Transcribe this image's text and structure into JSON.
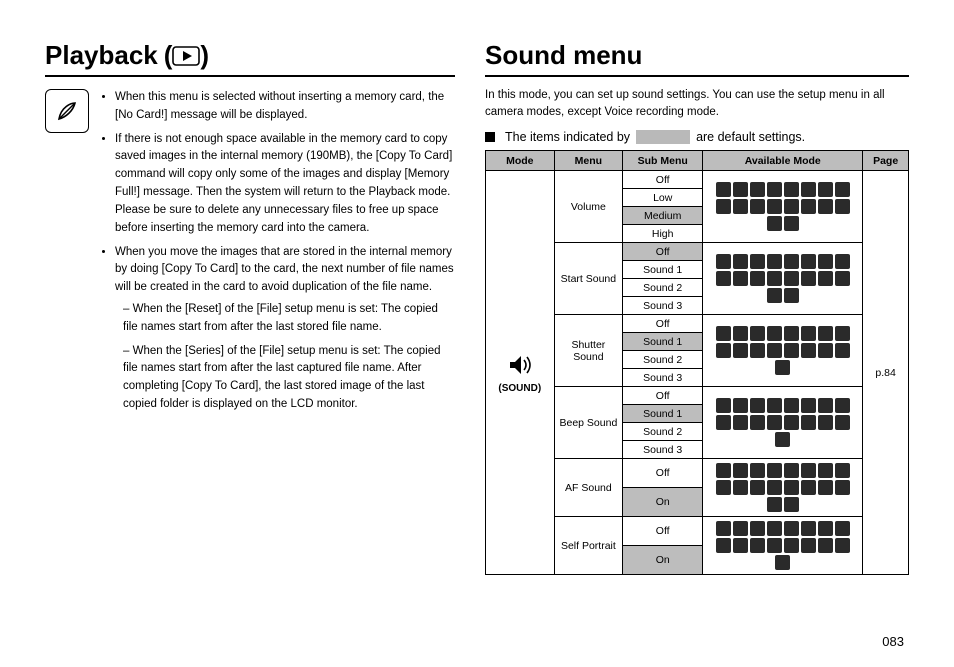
{
  "left": {
    "heading": "Playback",
    "bullets": [
      "When this menu is selected without inserting a memory card, the [No Card!] message will be displayed.",
      "If there is not enough space available in the memory card to copy saved images in the internal memory (190MB), the [Copy To Card] command will copy only some of the images and display [Memory Full!] message. Then the system will return to the Playback mode. Please be sure to delete any unnecessary files to free up space before inserting the memory card into the camera.",
      "When you move the images that are stored in the internal memory by doing [Copy To Card] to the card, the next number of file names will be created in the card to avoid duplication of the file name."
    ],
    "subpoints": [
      "When the [Reset] of the [File] setup menu is set: The copied file names start from after the last stored file name.",
      "When the [Series] of the [File] setup menu is set: The copied file names start from after the last captured file name. After completing [Copy To Card], the last stored image of the last copied folder is displayed on the LCD monitor."
    ]
  },
  "right": {
    "heading": "Sound menu",
    "intro": "In this mode, you can set up sound settings. You can use the setup menu in all camera modes, except Voice recording mode.",
    "default_note_pre": "The items indicated by",
    "default_note_post": "are default settings.",
    "table": {
      "headers": [
        "Mode",
        "Menu",
        "Sub Menu",
        "Available Mode",
        "Page"
      ],
      "mode_label": "(SOUND)",
      "page_ref": "p.84",
      "icon_count_full": 18,
      "icon_count_small": 17,
      "groups": [
        {
          "menu": "Volume",
          "items": [
            "Off",
            "Low",
            "Medium",
            "High"
          ],
          "default": "Medium",
          "icons": 18
        },
        {
          "menu": "Start Sound",
          "items": [
            "Off",
            "Sound 1",
            "Sound 2",
            "Sound 3"
          ],
          "default": "Off",
          "icons": 18
        },
        {
          "menu": "Shutter Sound",
          "items": [
            "Off",
            "Sound 1",
            "Sound 2",
            "Sound 3"
          ],
          "default": "Sound 1",
          "icons": 17
        },
        {
          "menu": "Beep Sound",
          "items": [
            "Off",
            "Sound 1",
            "Sound 2",
            "Sound 3"
          ],
          "default": "Sound 1",
          "icons": 17
        },
        {
          "menu": "AF Sound",
          "items": [
            "Off",
            "On"
          ],
          "default": "On",
          "icons": 18
        },
        {
          "menu": "Self Portrait",
          "items": [
            "Off",
            "On"
          ],
          "default": "On",
          "icons": 17
        }
      ]
    }
  },
  "page_number": "083"
}
